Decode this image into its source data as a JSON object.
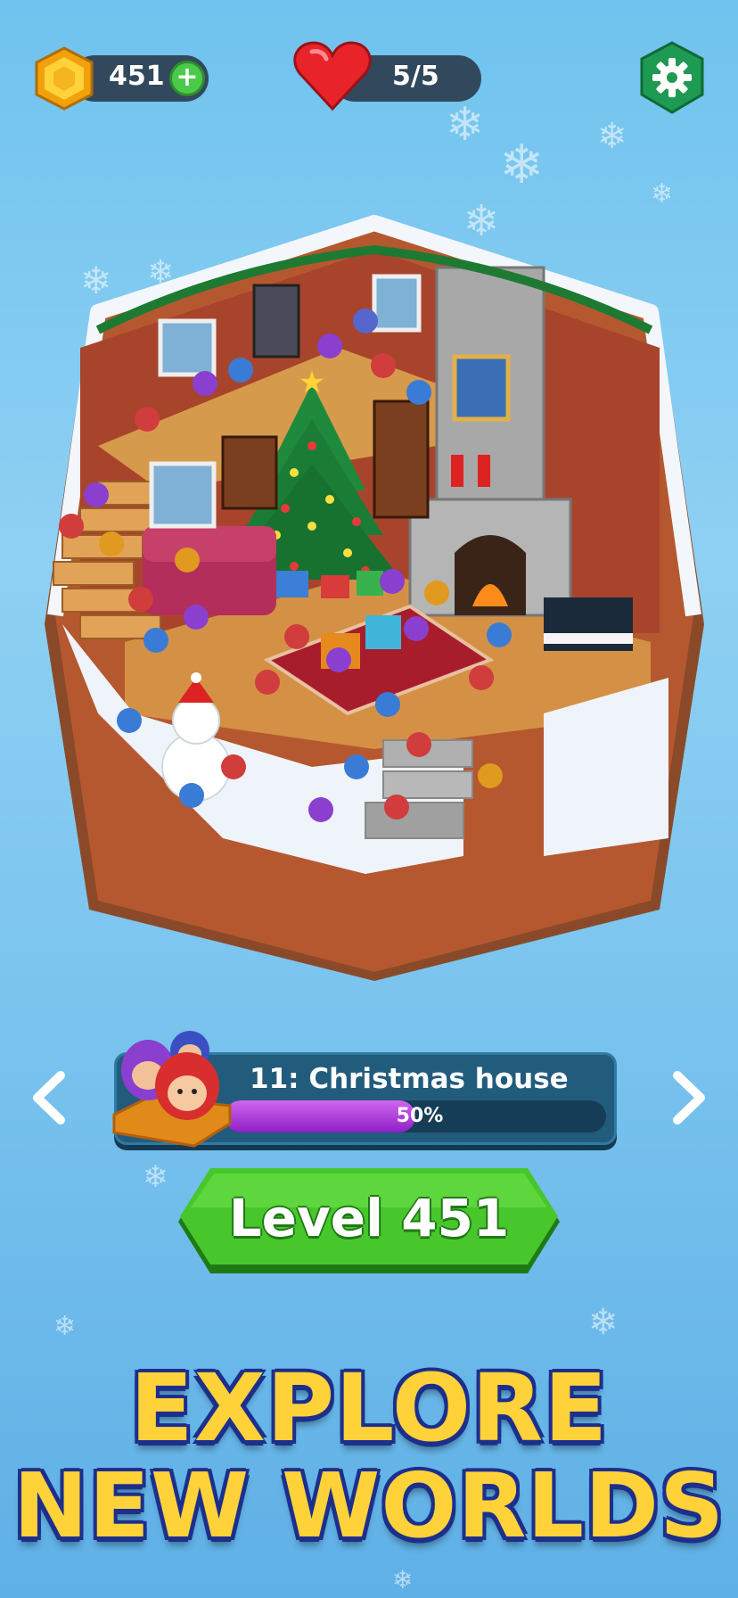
{
  "hud": {
    "coins": "451",
    "lives": "5/5",
    "coin_icon": "gold-hexagon-coin-icon",
    "plus_icon": "plus-icon",
    "heart_icon": "heart-icon",
    "settings_icon": "gear-icon"
  },
  "level_card": {
    "title": "11: Christmas house",
    "progress_label": "50%",
    "progress_fraction": 0.5
  },
  "level_button": {
    "label": "Level 451"
  },
  "banner": {
    "line1": "EXPLORE",
    "line2": "NEW WORLDS"
  },
  "colors": {
    "accent_green": "#4cc94a",
    "progress_purple": "#b23fe0",
    "banner_yellow": "#ffd23a",
    "banner_outline": "#1d2f8c"
  }
}
